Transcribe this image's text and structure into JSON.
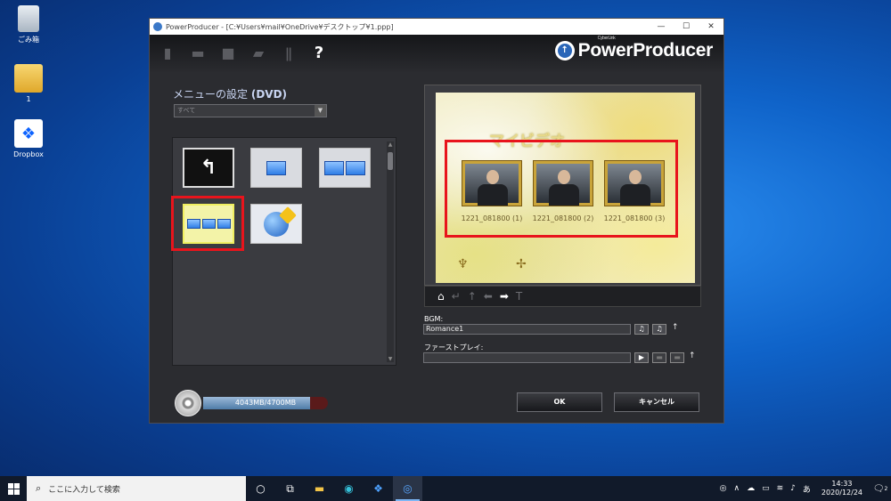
{
  "desktop": {
    "icons": [
      {
        "label": "ごみ箱",
        "icon": "recycle-bin-icon"
      },
      {
        "label": "1",
        "icon": "folder-icon"
      },
      {
        "label": "Dropbox",
        "icon": "dropbox-icon"
      }
    ]
  },
  "window": {
    "title": "PowerProducer - [C:¥Users¥mail¥OneDrive¥デスクトップ¥1.ppp]",
    "controls": {
      "minimize": "—",
      "maximize": "☐",
      "close": "✕"
    }
  },
  "toolbar": {
    "help": "?",
    "brand": "PowerProducer",
    "brand_small": "CyberLink"
  },
  "menu_settings": {
    "title": "メニューの設定",
    "title_suffix": "(DVD)",
    "filter_value": "すべて"
  },
  "preview": {
    "menu_title": "マイビデオ",
    "clips": [
      {
        "label": "1221_081800 (1)"
      },
      {
        "label": "1221_081800 (2)"
      },
      {
        "label": "1221_081800 (3)"
      }
    ]
  },
  "bgm": {
    "label": "BGM:",
    "value": "Romance1"
  },
  "first_play": {
    "label": "ファーストプレイ:",
    "value": ""
  },
  "capacity": {
    "text": "4043MB/4700MB",
    "used_fraction": 0.86
  },
  "buttons": {
    "ok": "OK",
    "cancel": "キャンセル"
  },
  "taskbar": {
    "search_placeholder": "ここに入力して検索",
    "time": "14:33",
    "date": "2020/12/24",
    "ime": "あ",
    "notification_count": "2"
  }
}
